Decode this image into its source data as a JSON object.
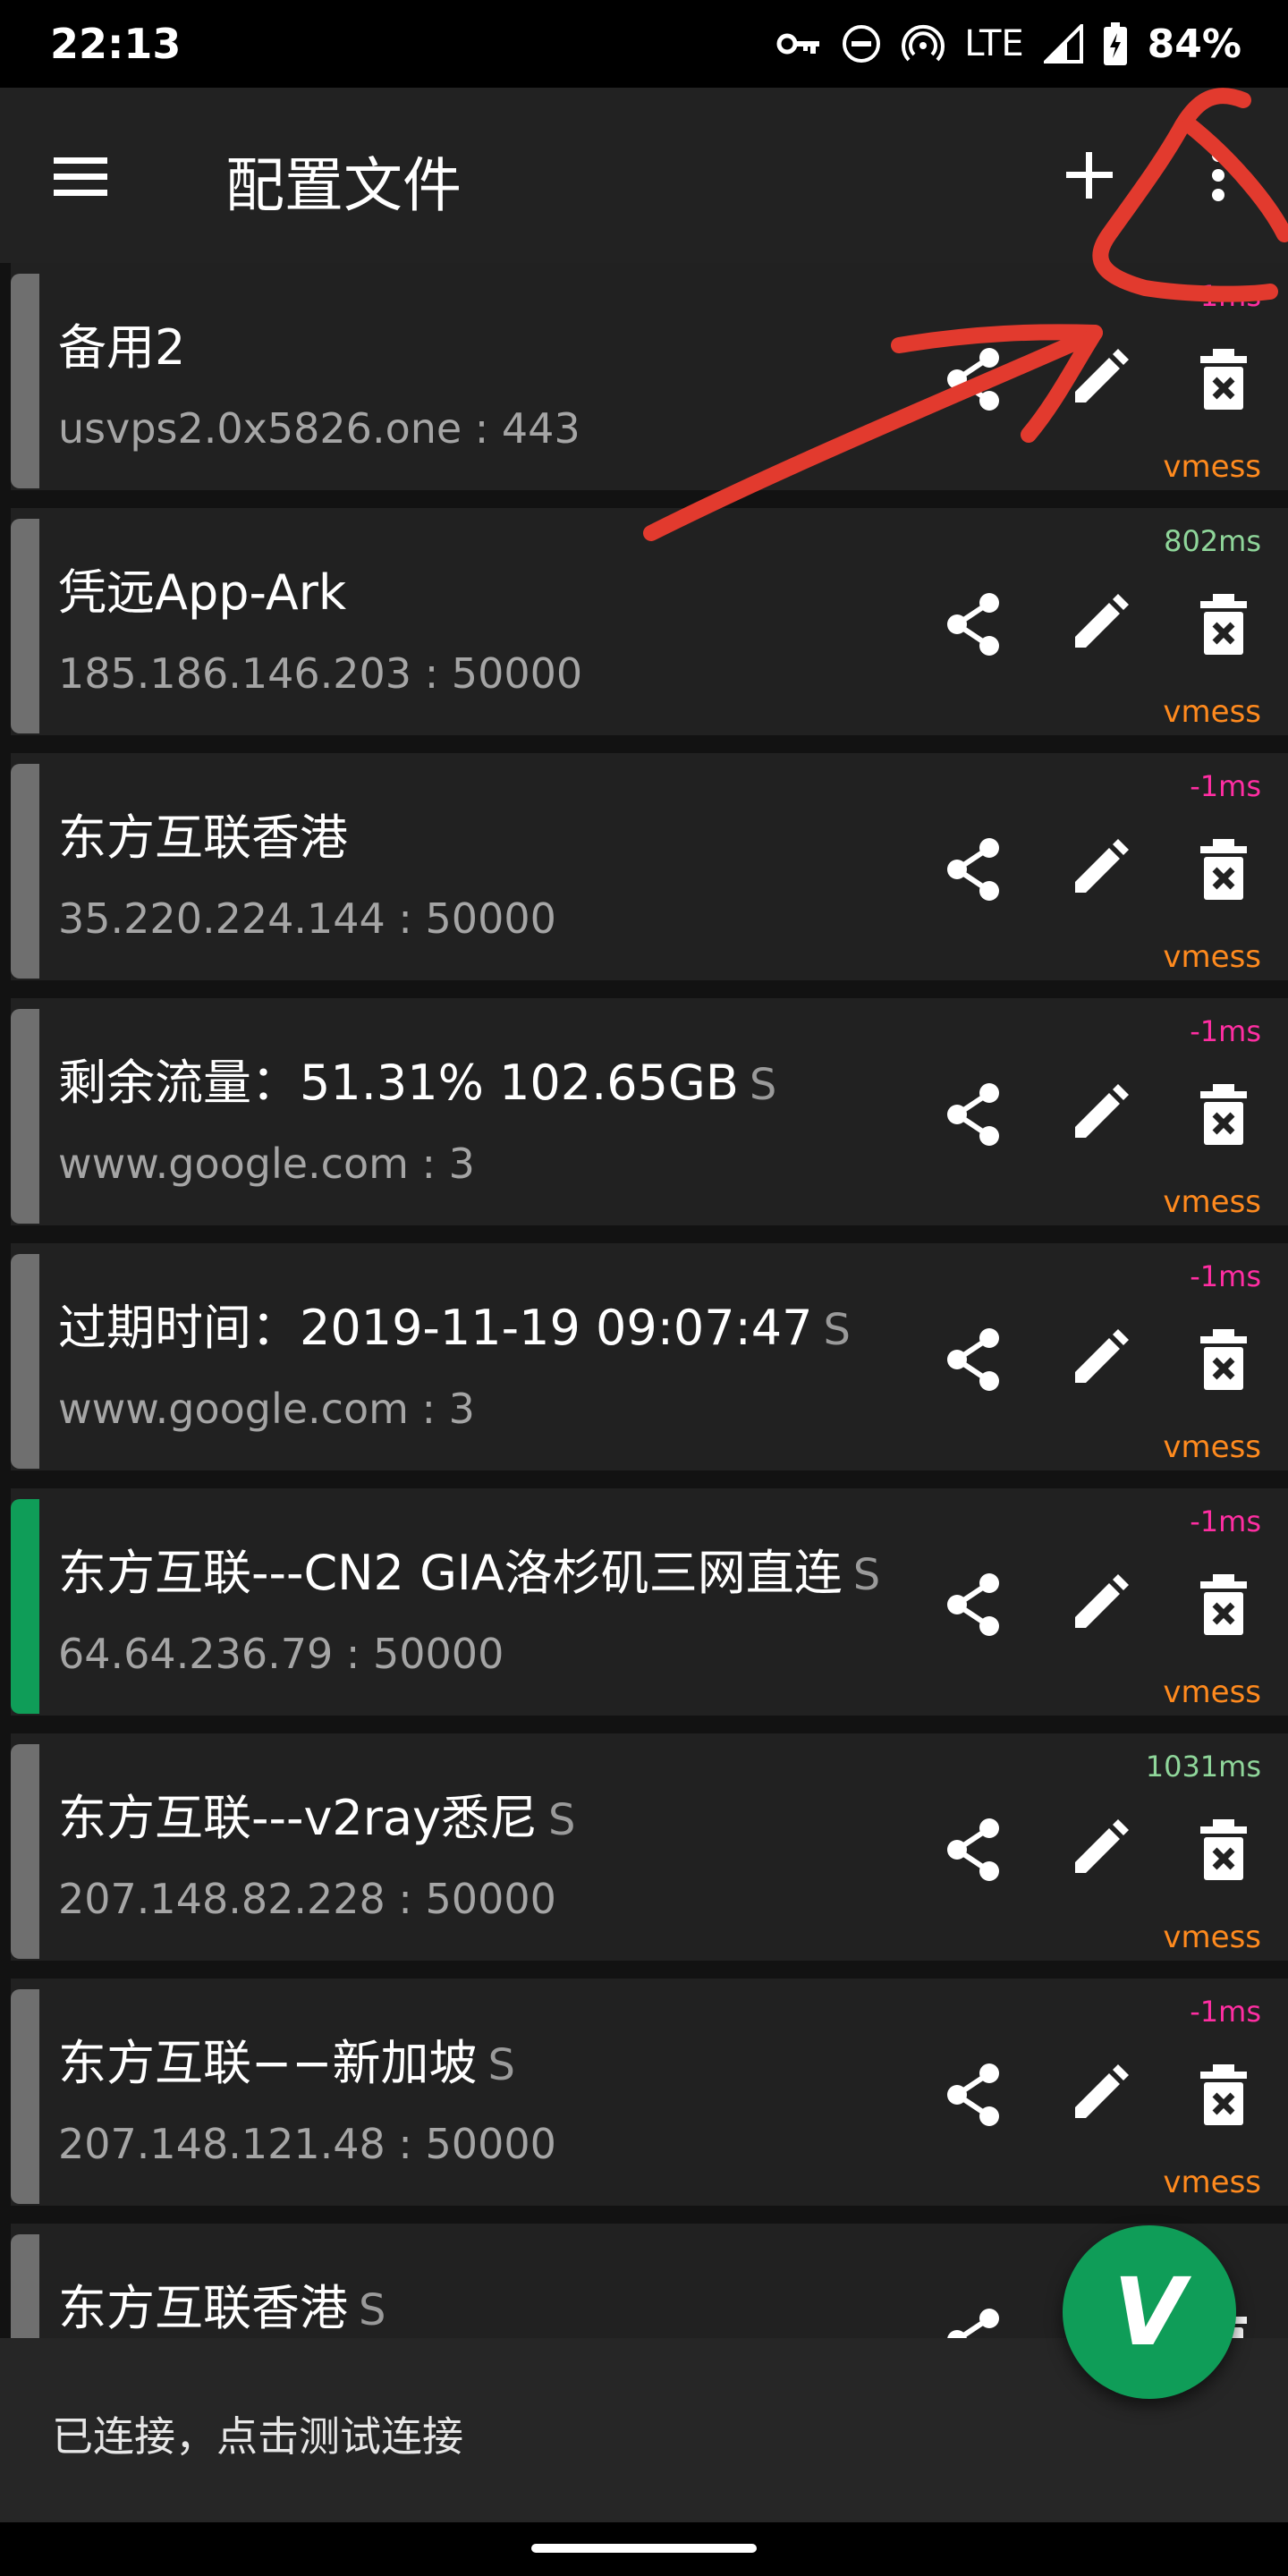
{
  "status_bar": {
    "time": "22:13",
    "network": "LTE",
    "battery": "84%",
    "icons": [
      "vpn-key-icon",
      "do-not-disturb-icon",
      "hotspot-icon",
      "signal-icon",
      "battery-charging-icon"
    ]
  },
  "app_bar": {
    "title": "配置文件",
    "icons": [
      "menu-icon",
      "add-icon",
      "more-vert-icon"
    ]
  },
  "colors": {
    "latency_ok": "#8fd69a",
    "latency_fail": "#ff2ea2",
    "type": "#ff8a1e",
    "selected_bar": "#0f9d58",
    "bar": "#6f6f6f",
    "annotation": "#e23a2e"
  },
  "profiles": [
    {
      "name": "备用2",
      "suffix": "",
      "address": "usvps2.0x5826.one : 443",
      "latency": "-1ms",
      "latency_ok": false,
      "type": "vmess",
      "selected": false
    },
    {
      "name": "凭远App-Ark",
      "suffix": "",
      "address": "185.186.146.203 : 50000",
      "latency": "802ms",
      "latency_ok": true,
      "type": "vmess",
      "selected": false
    },
    {
      "name": "东方互联香港",
      "suffix": "",
      "address": "35.220.224.144 : 50000",
      "latency": "-1ms",
      "latency_ok": false,
      "type": "vmess",
      "selected": false
    },
    {
      "name": "剩余流量：51.31% 102.65GB",
      "suffix": "S",
      "address": "www.google.com : 3",
      "latency": "-1ms",
      "latency_ok": false,
      "type": "vmess",
      "selected": false
    },
    {
      "name": "过期时间：2019-11-19 09:07:47",
      "suffix": "S",
      "address": "www.google.com : 3",
      "latency": "-1ms",
      "latency_ok": false,
      "type": "vmess",
      "selected": false
    },
    {
      "name": "东方互联---CN2 GIA洛杉矶三网直连",
      "suffix": "S",
      "address": "64.64.236.79 : 50000",
      "latency": "-1ms",
      "latency_ok": false,
      "type": "vmess",
      "selected": true
    },
    {
      "name": "东方互联---v2ray悉尼",
      "suffix": "S",
      "address": "207.148.82.228 : 50000",
      "latency": "1031ms",
      "latency_ok": true,
      "type": "vmess",
      "selected": false
    },
    {
      "name": "东方互联−−新加坡",
      "suffix": "S",
      "address": "207.148.121.48 : 50000",
      "latency": "-1ms",
      "latency_ok": false,
      "type": "vmess",
      "selected": false
    },
    {
      "name": "东方互联香港",
      "suffix": "S",
      "address": "",
      "latency": "",
      "latency_ok": true,
      "type": "",
      "selected": false
    }
  ],
  "row_icons": [
    "share-icon",
    "edit-icon",
    "delete-icon"
  ],
  "footer": {
    "status": "已连接，点击测试连接"
  },
  "fab": {
    "label": "V",
    "icon": "v2ray-logo-icon"
  }
}
